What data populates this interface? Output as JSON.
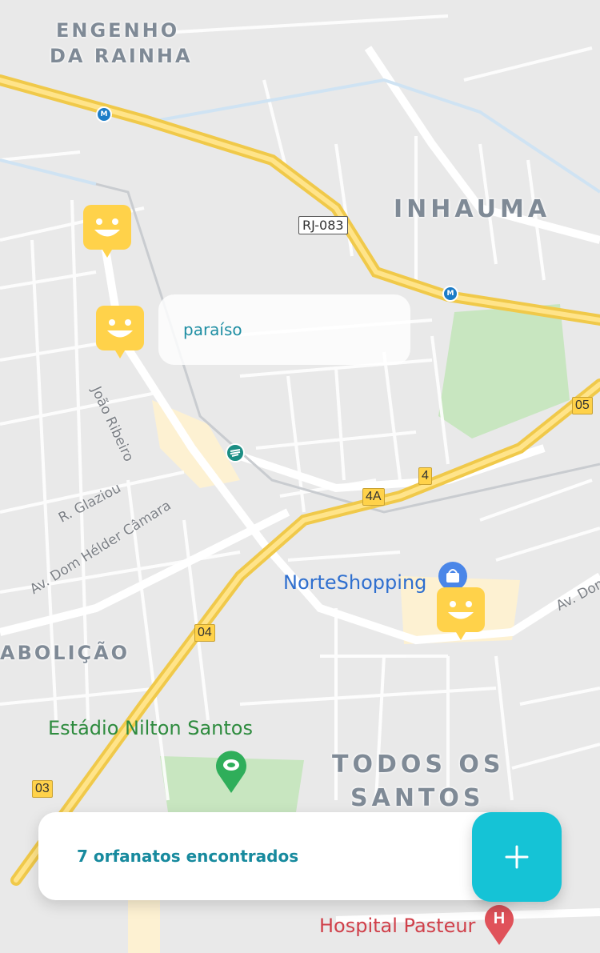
{
  "colors": {
    "accent": "#15c3d6",
    "accent_text": "#178a9e",
    "marker": "#ffd24a",
    "highway": "#ffd24a",
    "park": "#c8e6c0",
    "map_bg": "#e9e9e9"
  },
  "map": {
    "districts": [
      "ENGENHO",
      "DA RAINHA",
      "INHAUMA",
      "ABOLIÇÃO",
      "TODOS OS",
      "SANTOS"
    ],
    "streets": [
      "João Ribeiro",
      "R. Glaziou",
      "Av. Dom Hélder Câmara",
      "Av. Dom"
    ],
    "route_shields": [
      "RJ-083",
      "05",
      "4",
      "4A",
      "04",
      "03"
    ],
    "metro_symbol": "M",
    "pois": [
      "NorteShopping",
      "Estádio Nilton Santos",
      "Hospital Pasteur"
    ],
    "icons": [
      "metro-icon",
      "metro-icon",
      "train-station-icon",
      "shopping-bag-icon",
      "stadium-icon",
      "hospital-icon"
    ]
  },
  "markers": {
    "count": 3,
    "icon": "smiley-face-icon"
  },
  "popup": {
    "title": "paraíso"
  },
  "footer": {
    "text": "7 orfanatos encontrados"
  },
  "fab": {
    "icon": "plus-icon"
  }
}
